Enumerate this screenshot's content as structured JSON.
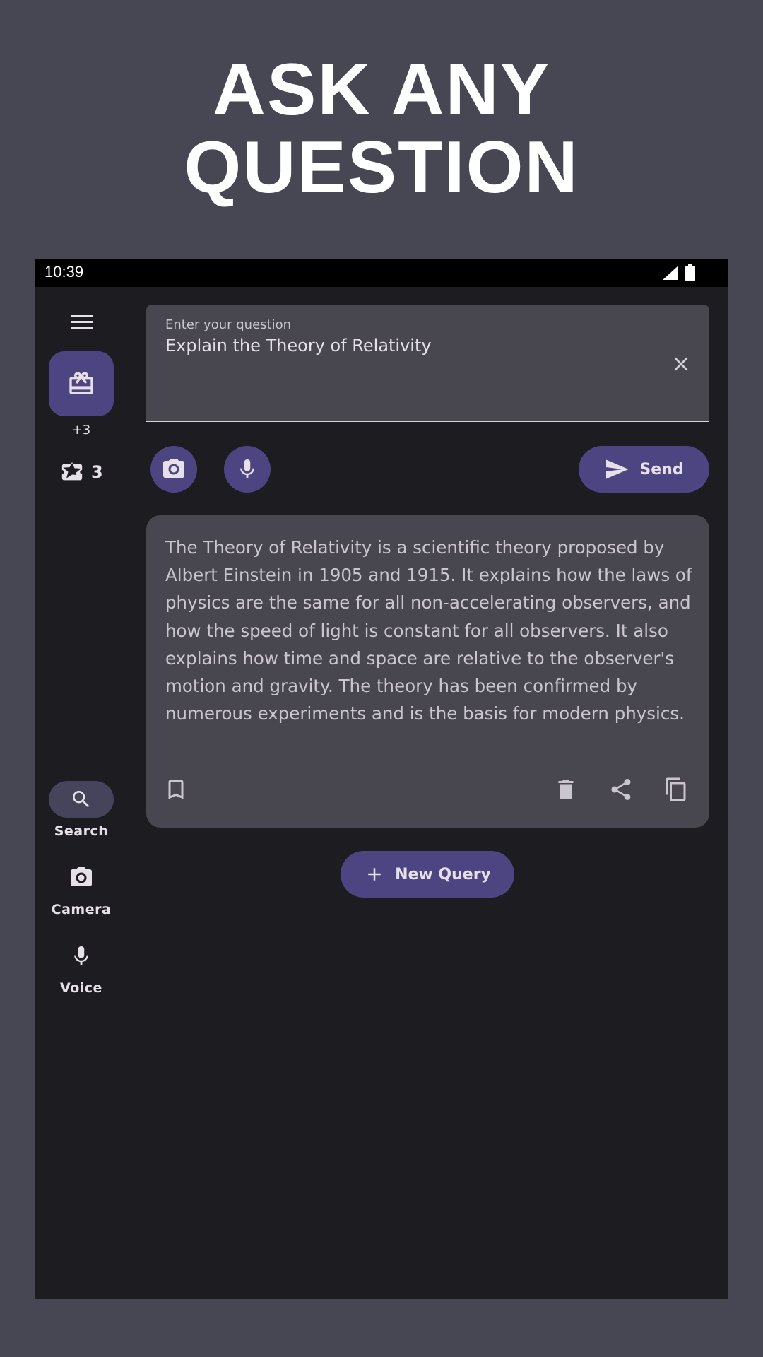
{
  "headline": {
    "line1": "ASK ANY",
    "line2": "QUESTION"
  },
  "status_bar": {
    "time": "10:39"
  },
  "rail": {
    "plus_count": "+3",
    "ticket_count": "3",
    "items": [
      {
        "label": "Search",
        "icon": "search-icon",
        "active": true
      },
      {
        "label": "Camera",
        "icon": "camera-icon",
        "active": false
      },
      {
        "label": "Voice",
        "icon": "mic-icon",
        "active": false
      }
    ]
  },
  "question_field": {
    "label": "Enter your question",
    "value": "Explain the Theory of Relativity"
  },
  "actions": {
    "send_label": "Send"
  },
  "answer": {
    "text": "The Theory of Relativity is a scientific theory proposed by Albert Einstein in 1905 and 1915. It explains how the laws of physics are the same for all non-accelerating observers, and how the speed of light is constant for all observers. It also explains how time and space are relative to the observer's motion and gravity. The theory has been confirmed by numerous experiments and is the basis for modern physics."
  },
  "new_query": {
    "label": "New Query"
  },
  "colors": {
    "background": "#474753",
    "surface": "#1d1c21",
    "container": "#48474f",
    "accent": "#4d4582",
    "on_surface": "#e6e1e9"
  }
}
